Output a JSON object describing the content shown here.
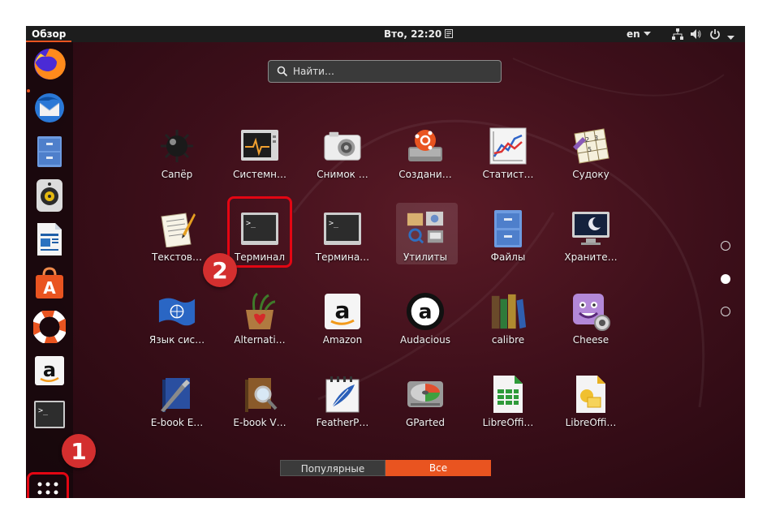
{
  "topbar": {
    "activities_label": "Обзор",
    "clock": "Вто, 22:20",
    "language": "en"
  },
  "search": {
    "placeholder": "Найти…"
  },
  "apps": [
    {
      "label": "Сапёр",
      "icon": "mine-icon"
    },
    {
      "label": "Системн…",
      "icon": "system-monitor-icon"
    },
    {
      "label": "Снимок …",
      "icon": "camera-icon"
    },
    {
      "label": "Создани…",
      "icon": "startup-disk-icon"
    },
    {
      "label": "Статист…",
      "icon": "statistics-chart-icon"
    },
    {
      "label": "Судоку",
      "icon": "sudoku-icon"
    },
    {
      "label": "Текстов…",
      "icon": "text-editor-icon"
    },
    {
      "label": "Терминал",
      "icon": "terminal-icon"
    },
    {
      "label": "Термина…",
      "icon": "terminal-icon"
    },
    {
      "label": "Утилиты",
      "icon": "utilities-folder-icon"
    },
    {
      "label": "Файлы",
      "icon": "file-cabinet-icon"
    },
    {
      "label": "Храните…",
      "icon": "screensaver-monitor-icon"
    },
    {
      "label": "Язык сис…",
      "icon": "un-flag-icon"
    },
    {
      "label": "Alternati…",
      "icon": "alternatives-icon"
    },
    {
      "label": "Amazon",
      "icon": "amazon-icon"
    },
    {
      "label": "Audacious",
      "icon": "audacious-icon"
    },
    {
      "label": "calibre",
      "icon": "calibre-books-icon"
    },
    {
      "label": "Cheese",
      "icon": "cheese-icon"
    },
    {
      "label": "E-book E…",
      "icon": "ebook-editor-icon"
    },
    {
      "label": "E-book V…",
      "icon": "ebook-viewer-icon"
    },
    {
      "label": "FeatherP…",
      "icon": "featherpad-icon"
    },
    {
      "label": "GParted",
      "icon": "gparted-icon"
    },
    {
      "label": "LibreOffi…",
      "icon": "libreoffice-calc-icon"
    },
    {
      "label": "LibreOffi…",
      "icon": "libreoffice-draw-icon"
    }
  ],
  "switcher": {
    "frequent_label": "Популярные",
    "all_label": "Все"
  },
  "callouts": {
    "first": "1",
    "second": "2"
  },
  "pages": {
    "count": 3,
    "active": 2
  },
  "colors": {
    "accent": "#e95420",
    "highlight": "#e30613",
    "topbar": "#1d1d1d"
  }
}
